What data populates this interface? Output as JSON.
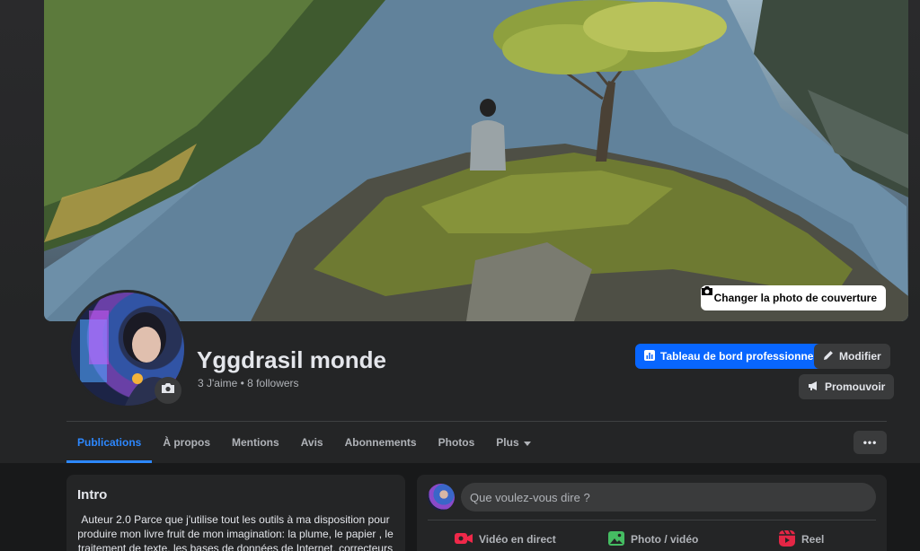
{
  "cover": {
    "change_label": "Changer la photo de couverture"
  },
  "profile": {
    "name": "Yggdrasil monde",
    "stats": "3 J'aime • 8 followers"
  },
  "actions": {
    "dashboard": "Tableau de bord professionnel",
    "edit": "Modifier",
    "promote": "Promouvoir"
  },
  "tabs": [
    "Publications",
    "À propos",
    "Mentions",
    "Avis",
    "Abonnements",
    "Photos",
    "Plus"
  ],
  "more_label": "•••",
  "intro": {
    "title": "Intro",
    "text": "Auteur 2.0 Parce que j'utilise tout les outils à ma disposition pour produire mon livre fruit de mon imagination: la plume, le papier , le traitement de texte, les bases de données de Internet, correcteurs"
  },
  "composer": {
    "placeholder": "Que voulez-vous dire ?",
    "live": "Vidéo en direct",
    "photo": "Photo / vidéo",
    "reel": "Reel"
  },
  "colors": {
    "accent": "#0866ff",
    "active_tab": "#2d88ff",
    "live": "#f02849",
    "photo": "#45bd62",
    "reel": "#e42645"
  },
  "icons": [
    "camera-icon",
    "dashboard-icon",
    "pencil-icon",
    "megaphone-icon",
    "caret-down-icon",
    "live-video-icon",
    "photo-icon",
    "reel-icon"
  ]
}
